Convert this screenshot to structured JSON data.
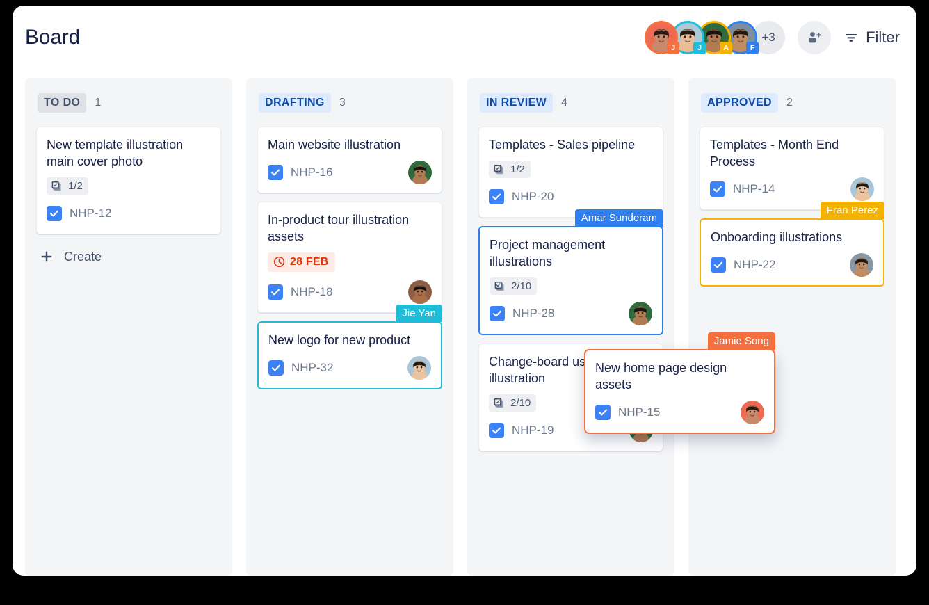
{
  "header": {
    "title": "Board",
    "avatars": [
      {
        "name": "member-1",
        "initial": "J",
        "ring": "#F4703F",
        "badge_color": "#F4703F",
        "skin": "#C98A6B",
        "hair": "#2B1B16",
        "bg": "#EE6A52"
      },
      {
        "name": "member-2",
        "initial": "J",
        "ring": "#22BDD8",
        "badge_color": "#22BDD8",
        "skin": "#E8BE98",
        "hair": "#241A14",
        "bg": "#AFC9D6"
      },
      {
        "name": "member-3",
        "initial": "A",
        "ring": "#F5B301",
        "badge_color": "#F5B301",
        "skin": "#B07A52",
        "hair": "#1C1410",
        "bg": "#2F6B3C"
      },
      {
        "name": "member-4",
        "initial": "F",
        "ring": "#2F7FEE",
        "badge_color": "#2F7FEE",
        "skin": "#C08C64",
        "hair": "#241811",
        "bg": "#7E8E9C"
      }
    ],
    "more_count": "+3",
    "add_person_label": "add-person",
    "filter_label": "Filter"
  },
  "columns": [
    {
      "id": "todo",
      "label": "TO DO",
      "badge_style": "gray",
      "count": "1",
      "create_label": "Create",
      "show_create": true,
      "cards": [
        {
          "title": "New template illustration main cover photo",
          "subtasks": "1/2",
          "key": "NHP-12",
          "due": null,
          "avatar": null,
          "selection": null,
          "tag": null
        }
      ]
    },
    {
      "id": "drafting",
      "label": "DRAFTING",
      "badge_style": "blue",
      "count": "3",
      "create_label": "Create",
      "show_create": false,
      "cards": [
        {
          "title": "Main website illustration",
          "subtasks": null,
          "key": "NHP-16",
          "due": null,
          "avatar": {
            "skin": "#B07A52",
            "hair": "#1C1410",
            "bg": "#2F6B3C"
          },
          "selection": null,
          "tag": null
        },
        {
          "title": "In-product tour illustration assets",
          "subtasks": null,
          "key": "NHP-18",
          "due": "28 FEB",
          "avatar": {
            "skin": "#A8704A",
            "hair": "#1A1110",
            "bg": "#8C5E44"
          },
          "selection": null,
          "tag": null
        },
        {
          "title": "New logo for new product",
          "subtasks": null,
          "key": "NHP-32",
          "due": null,
          "avatar": {
            "skin": "#EBC49F",
            "hair": "#241A14",
            "bg": "#A9C6D6"
          },
          "selection": "cyan",
          "tag": {
            "text": "Jie Yan",
            "style": "cyan"
          }
        }
      ]
    },
    {
      "id": "inreview",
      "label": "IN REVIEW",
      "badge_style": "blue",
      "count": "4",
      "create_label": "Create",
      "show_create": false,
      "cards": [
        {
          "title": "Templates - Sales pipeline",
          "subtasks": "1/2",
          "key": "NHP-20",
          "due": null,
          "avatar": null,
          "selection": null,
          "tag": null
        },
        {
          "title": "Project management illustrations",
          "subtasks": "2/10",
          "key": "NHP-28",
          "due": null,
          "avatar": {
            "skin": "#B07A52",
            "hair": "#1C1410",
            "bg": "#2F6B3C"
          },
          "selection": "blue",
          "tag": {
            "text": "Amar Sunderam",
            "style": "blue"
          }
        },
        {
          "title": "Change-board users illustration",
          "subtasks": "2/10",
          "key": "NHP-19",
          "due": null,
          "avatar": {
            "skin": "#B07A52",
            "hair": "#1C1410",
            "bg": "#2F6B3C"
          },
          "selection": null,
          "tag": null
        }
      ]
    },
    {
      "id": "approved",
      "label": "APPROVED",
      "badge_style": "blue",
      "count": "2",
      "create_label": "Create",
      "show_create": false,
      "cards": [
        {
          "title": "Templates - Month End Process",
          "subtasks": null,
          "key": "NHP-14",
          "due": null,
          "avatar": {
            "skin": "#EBC49F",
            "hair": "#241A14",
            "bg": "#A9C6D6"
          },
          "selection": null,
          "tag": null
        },
        {
          "title": "Onboarding illustrations",
          "subtasks": null,
          "key": "NHP-22",
          "due": null,
          "avatar": {
            "skin": "#C08C64",
            "hair": "#241811",
            "bg": "#8A97A4"
          },
          "selection": "amber",
          "tag": {
            "text": "Fran Perez",
            "style": "amber"
          }
        }
      ]
    }
  ],
  "dragged_card": {
    "title": "New home page design assets",
    "key": "NHP-15",
    "tag": {
      "text": "Jamie Song",
      "style": "coral"
    },
    "avatar": {
      "skin": "#C98A6B",
      "hair": "#2B1B16",
      "bg": "#EE6A52"
    }
  },
  "colors": {
    "accent_blue": "#3B82F6",
    "select_cyan": "#20BDD8",
    "select_blue": "#2F7FEE",
    "select_amber": "#F5B301",
    "select_coral": "#F4703F",
    "due_red": "#DE350B",
    "column_bg": "#F4F5F7"
  }
}
